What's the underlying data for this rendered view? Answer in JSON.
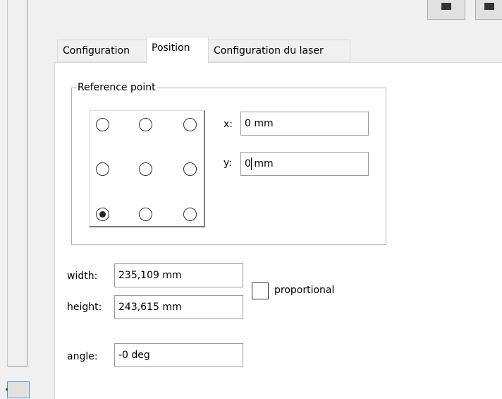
{
  "tabs": [
    {
      "label": "Configuration",
      "active": false
    },
    {
      "label": "Position",
      "active": true
    },
    {
      "label": "Configuration du laser",
      "active": false
    }
  ],
  "reference_point": {
    "legend": "Reference point",
    "selected": "bottom-left",
    "x_label": "x:",
    "x_value": "0 mm",
    "y_label": "y:",
    "y_value": "0 mm"
  },
  "dimensions": {
    "width_label": "width:",
    "width_value": "235,109 mm",
    "height_label": "height:",
    "height_value": "243,615 mm",
    "proportional_label": "proportional",
    "proportional_checked": false,
    "angle_label": "angle:",
    "angle_value": "-0 deg"
  }
}
